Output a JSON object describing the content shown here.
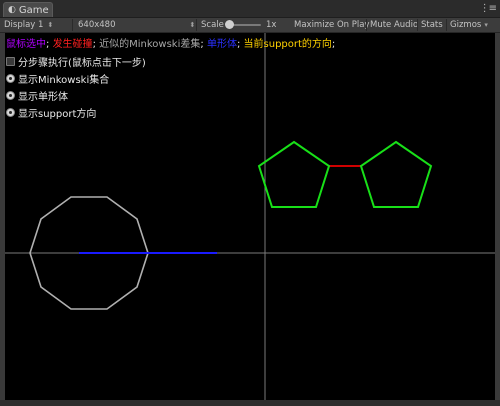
{
  "tab": {
    "title": "Game",
    "menu": "⋮≡"
  },
  "toolbar": {
    "display": "Display 1",
    "resolution": "640x480",
    "scale_label": "Scale",
    "scale_value": "1x",
    "maximize": "Maximize On Play",
    "mute": "Mute Audio",
    "stats": "Stats",
    "gizmos": "Gizmos"
  },
  "legend": {
    "item1": "鼠标选中",
    "sep": "; ",
    "item2": "发生碰撞",
    "item3": "近似的Minkowski差集",
    "item4": "单形体",
    "item5": "当前support的方向",
    "end": ";",
    "colors": {
      "item1": "#b000ff",
      "item2": "#ff2020",
      "item3": "#a8a8a8",
      "item4": "#2a30ff",
      "item5": "#ffd200",
      "sep": "#e0e0e0"
    }
  },
  "options": [
    {
      "label": "分步骤执行(鼠标点击下一步)",
      "checked": false
    },
    {
      "label": "显示Minkowski集合",
      "checked": true
    },
    {
      "label": "显示单形体",
      "checked": true
    },
    {
      "label": "显示support方向",
      "checked": true
    }
  ],
  "scene": {
    "axes_color": "#7a7a7a",
    "minkowski_color": "#b0b0b0",
    "simplex_color": "#1a1aff",
    "collision_link_color": "#d00000",
    "pentagon_color": "#18e018"
  }
}
